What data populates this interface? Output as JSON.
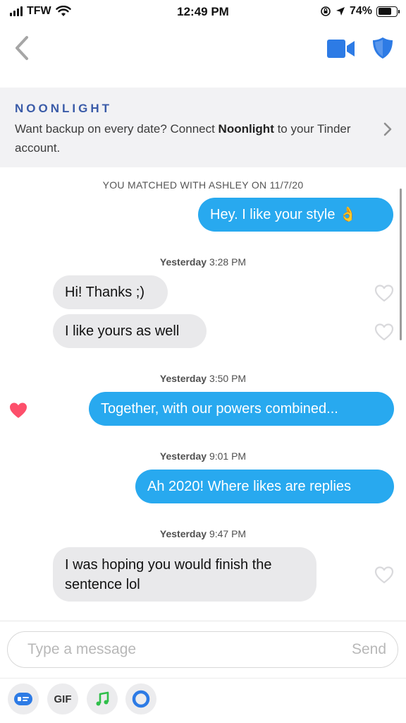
{
  "status_bar": {
    "carrier": "TFW",
    "time": "12:49 PM",
    "battery": "74%"
  },
  "nav": {
    "back_icon": "chevron-left-icon",
    "video_icon": "video-camera-icon",
    "safety_icon": "shield-icon",
    "accent_color": "#2d7be5"
  },
  "banner": {
    "brand": "NOONLIGHT",
    "text_before": "Want backup on every date? Connect ",
    "text_bold": "Noonlight",
    "text_after": " to your Tinder account."
  },
  "chat": {
    "match_line": "YOU MATCHED WITH ASHLEY ON 11/7/20",
    "timestamps": [
      {
        "day": "Yesterday",
        "time": "3:28 PM"
      },
      {
        "day": "Yesterday",
        "time": "3:50 PM"
      },
      {
        "day": "Yesterday",
        "time": "9:01 PM"
      },
      {
        "day": "Yesterday",
        "time": "9:47 PM"
      }
    ],
    "messages": [
      {
        "direction": "outgoing",
        "text": "Hey. I like your style 👌",
        "liked": false
      },
      {
        "direction": "incoming",
        "text": "Hi! Thanks ;)",
        "liked": false
      },
      {
        "direction": "incoming",
        "text": "I like yours as well",
        "liked": false
      },
      {
        "direction": "outgoing",
        "text": "Together, with our powers combined...",
        "liked": true
      },
      {
        "direction": "outgoing",
        "text": "Ah 2020! Where likes are replies",
        "liked": false
      },
      {
        "direction": "incoming",
        "text": "I was hoping you would finish the sentence lol",
        "liked": false
      }
    ],
    "colors": {
      "outgoing": "#28a9ef",
      "incoming": "#e9e9eb",
      "liked_heart": "#fd4f6b"
    }
  },
  "composer": {
    "placeholder": "Type a message",
    "send_label": "Send",
    "tools": [
      {
        "icon": "sticker-card-icon"
      },
      {
        "icon": "gif-icon",
        "label": "GIF"
      },
      {
        "icon": "music-note-icon"
      },
      {
        "icon": "noonlight-ring-icon"
      }
    ]
  }
}
